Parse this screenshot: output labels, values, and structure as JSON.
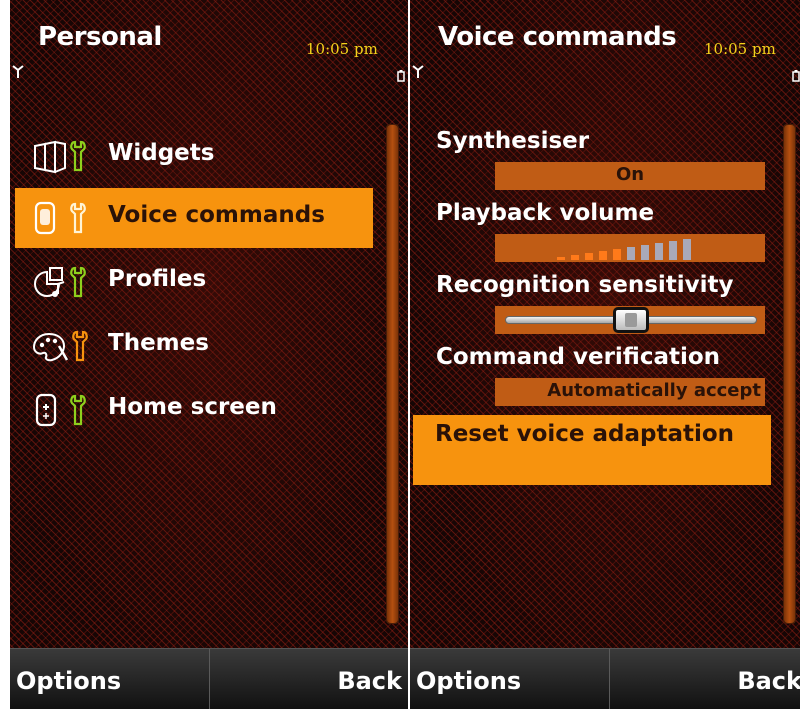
{
  "left": {
    "title": "Personal",
    "time": "10:05 pm",
    "menu": [
      {
        "label": "Widgets",
        "icon": "widgets-icon",
        "selected": false
      },
      {
        "label": "Voice commands",
        "icon": "voice-commands-icon",
        "selected": true
      },
      {
        "label": "Profiles",
        "icon": "profiles-icon",
        "selected": false
      },
      {
        "label": "Themes",
        "icon": "themes-icon",
        "selected": false
      },
      {
        "label": "Home screen",
        "icon": "home-screen-icon",
        "selected": false
      }
    ],
    "softkeys": {
      "left": "Options",
      "right": "Back"
    }
  },
  "right": {
    "title": "Voice commands",
    "time": "10:05 pm",
    "settings": {
      "synthesiser": {
        "label": "Synthesiser",
        "value": "On"
      },
      "playback_volume": {
        "label": "Playback volume",
        "level": 5,
        "max": 10
      },
      "recognition_sensitivity": {
        "label": "Recognition sensitivity",
        "level": 0.5
      },
      "command_verification": {
        "label": "Command verification",
        "value": "Automatically accept"
      },
      "reset": {
        "label": "Reset voice adaptation"
      }
    },
    "softkeys": {
      "left": "Options",
      "right": "Back"
    }
  },
  "colors": {
    "accent": "#f7930e",
    "value_box": "#c05c15",
    "clock": "#f3d21b",
    "tool_green": "#8ed01d",
    "tool_orange": "#f7930e"
  }
}
